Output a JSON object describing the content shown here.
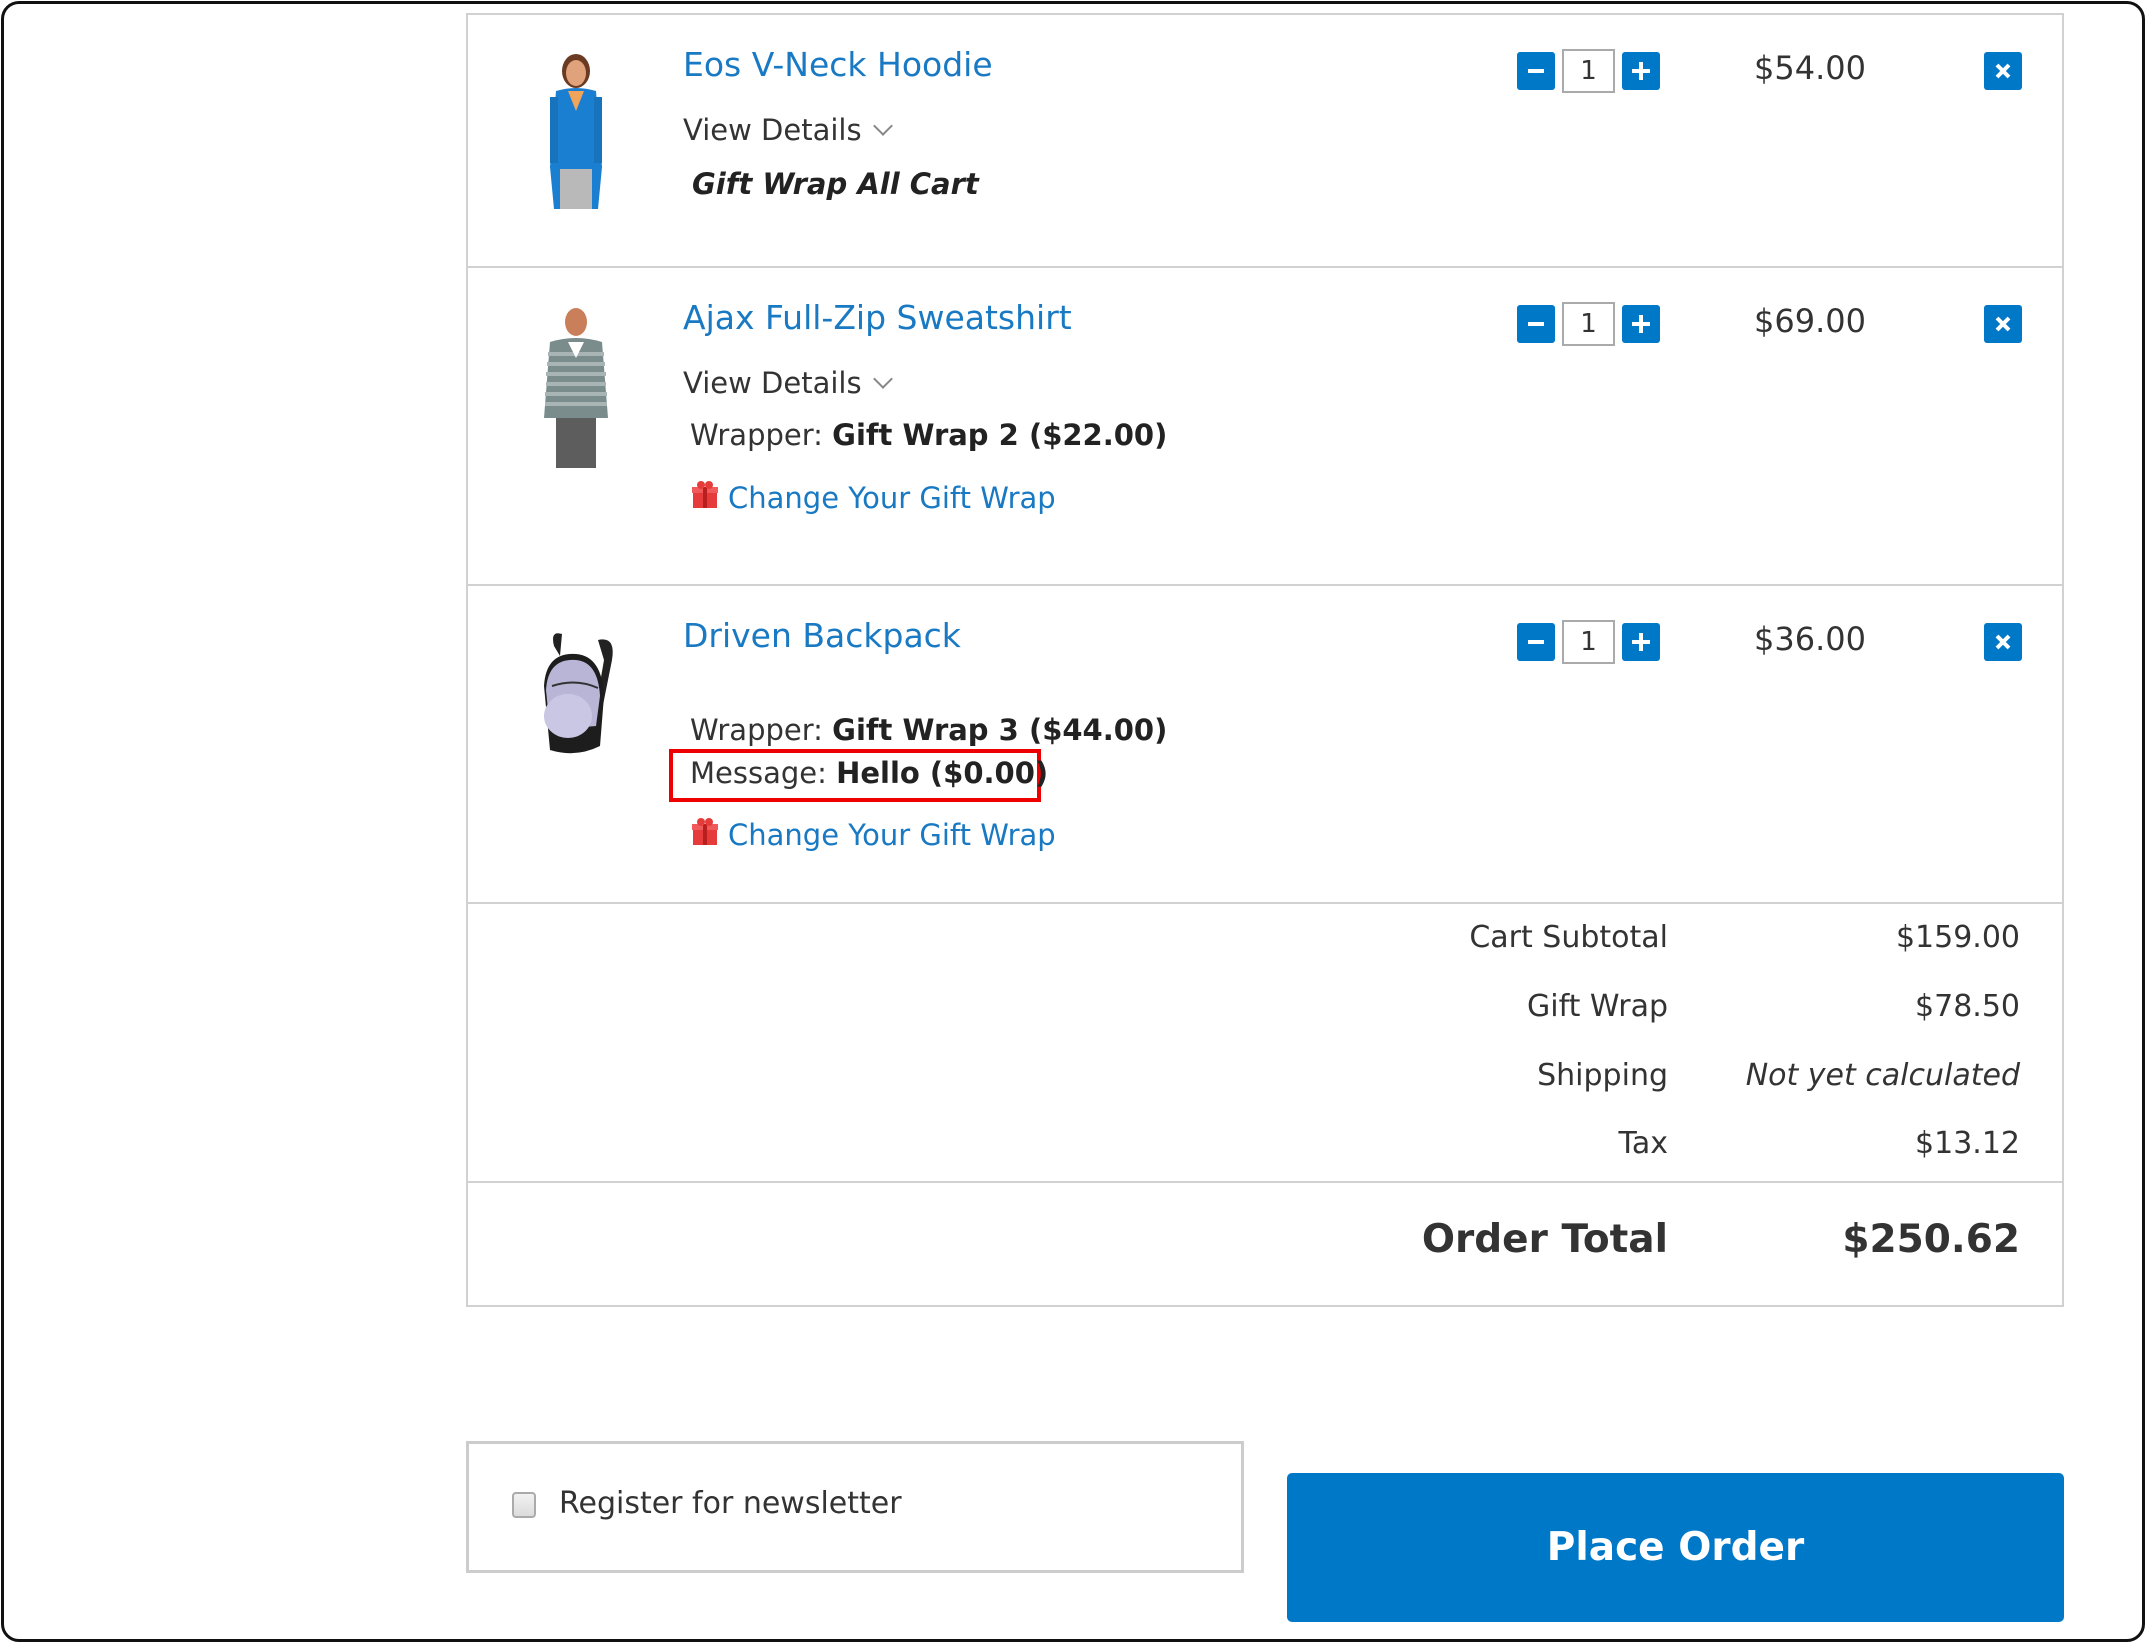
{
  "cart": {
    "items": [
      {
        "name": "Eos V-Neck Hoodie",
        "image": "woman-blue-hoodie",
        "view_details_label": "View Details",
        "gift_wrap_all_cart": "Gift Wrap All Cart",
        "quantity": "1",
        "price": "$54.00"
      },
      {
        "name": "Ajax Full-Zip Sweatshirt",
        "image": "man-striped-sweatshirt",
        "view_details_label": "View Details",
        "wrapper_label": "Wrapper:",
        "wrapper_value": "Gift Wrap 2 ($22.00)",
        "change_gift_wrap_label": "Change Your Gift Wrap",
        "quantity": "1",
        "price": "$69.00"
      },
      {
        "name": "Driven Backpack",
        "image": "gray-backpack",
        "wrapper_label": "Wrapper:",
        "wrapper_value": "Gift Wrap 3 ($44.00)",
        "message_label": "Message:",
        "message_value": "Hello ($0.00)",
        "change_gift_wrap_label": "Change Your Gift Wrap",
        "quantity": "1",
        "price": "$36.00"
      }
    ],
    "totals": [
      {
        "label": "Cart Subtotal",
        "value": "$159.00"
      },
      {
        "label": "Gift Wrap",
        "value": "$78.50"
      },
      {
        "label": "Shipping",
        "value": "Not yet calculated"
      },
      {
        "label": "Tax",
        "value": "$13.12"
      }
    ],
    "order_total": {
      "label": "Order Total",
      "value": "$250.62"
    }
  },
  "newsletter": {
    "label": "Register for newsletter",
    "checked": false
  },
  "place_order_label": "Place Order",
  "colors": {
    "accent": "#0078c8",
    "link": "#1979c3",
    "highlight": "#ee0000",
    "border": "#d1d1d1"
  },
  "icons": {
    "minus": "minus-icon",
    "plus": "plus-icon",
    "remove": "close-icon",
    "gift": "gift-icon",
    "chevron": "chevron-down-icon"
  }
}
